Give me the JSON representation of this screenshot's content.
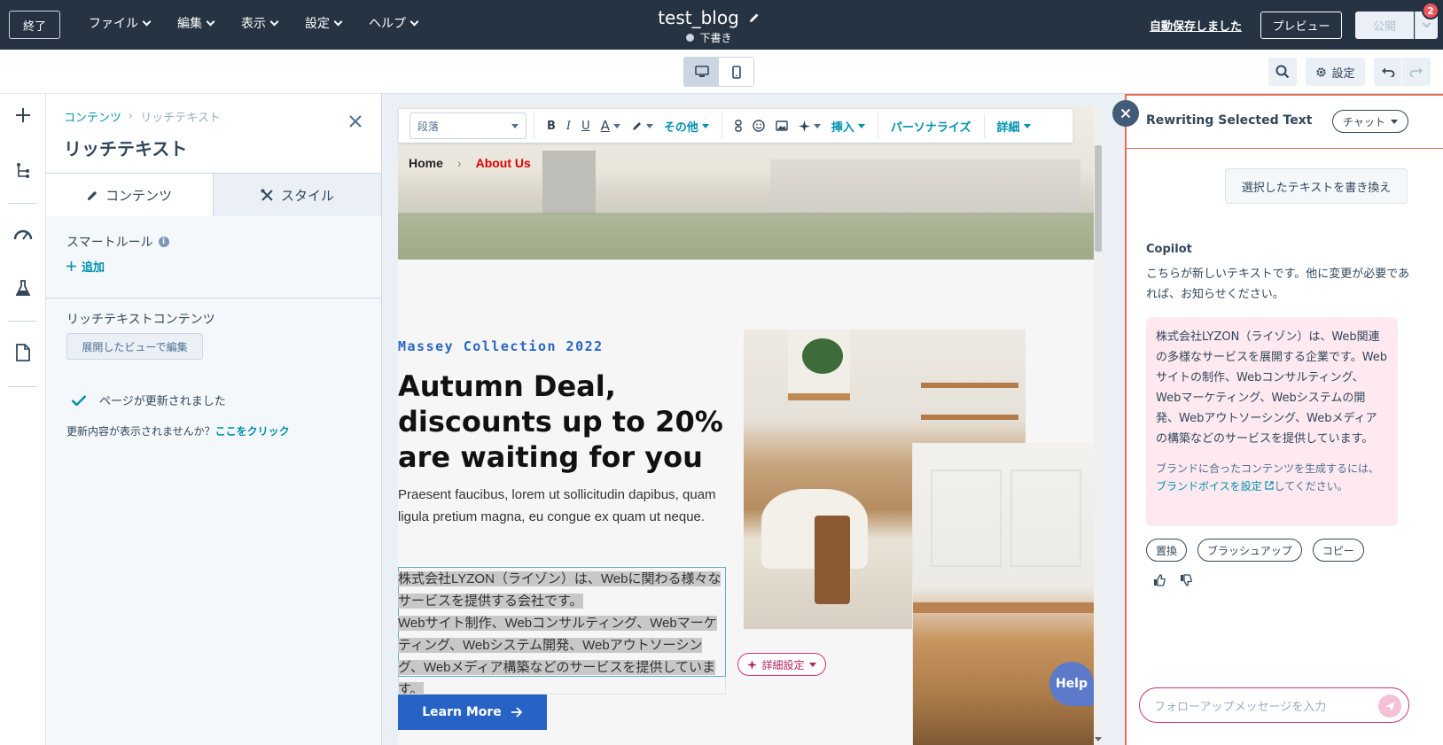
{
  "topbar": {
    "exit_label": "終了",
    "menu": [
      {
        "label": "ファイル"
      },
      {
        "label": "編集"
      },
      {
        "label": "表示"
      },
      {
        "label": "設定"
      },
      {
        "label": "ヘルプ"
      }
    ],
    "page_title": "test_blog",
    "status": "下書き",
    "autosave": "自動保存しました",
    "preview_label": "プレビュー",
    "publish_label": "公開",
    "notification_count": "2"
  },
  "viewbar": {
    "settings_label": "設定"
  },
  "sidepanel": {
    "breadcrumb_parent": "コンテンツ",
    "breadcrumb_current": "リッチテキスト",
    "title": "リッチテキスト",
    "tab_content": "コンテンツ",
    "tab_style": "スタイル",
    "smart_rule_label": "スマートルール",
    "add_label": "追加",
    "richtext_label": "リッチテキストコンテンツ",
    "expand_label": "展開したビューで編集",
    "updated_msg": "ページが更新されました",
    "refresh_hint": "更新内容が表示されませんか？",
    "refresh_link": "ここをクリック"
  },
  "rte": {
    "paragraph_select": "段落",
    "bold": "B",
    "italic": "I",
    "underline": "U",
    "font_color": "A",
    "more_label": "その他",
    "insert_label": "挿入",
    "personalize_label": "パーソナライズ",
    "detail_label": "詳細"
  },
  "page": {
    "breadcrumb_home": "Home",
    "breadcrumb_current": "About Us",
    "eyebrow": "Massey Collection 2022",
    "heading": "Autumn Deal, discounts up to 20% are waiting for you",
    "body": "Praesent faucibus, lorem ut sollicitudin dapibus, quam ligula pretium magna, eu congue ex quam ut neque.",
    "selected_line1": "株式会社LYZON（ライゾン）は、Webに関わる様々なサービスを提供する会社です。",
    "selected_line2": "Webサイト制作、Webコンサルティング、Webマーケティング、Webシステム開発、Webアウトソーシング、Webメディア構築などのサービスを提供しています。",
    "cta_label": "Learn More",
    "detail_settings": "詳細設定",
    "help_label": "Help"
  },
  "copilot": {
    "title": "Rewriting Selected Text",
    "mode_label": "チャット",
    "user_message": "選択したテキストを書き換え",
    "bot_name": "Copilot",
    "bot_intro": "こちらが新しいテキストです。他に変更が必要であれば、お知らせください。",
    "result_text": "株式会社LYZON（ライゾン）は、Web関連の多様なサービスを展開する企業です。Webサイトの制作、Webコンサルティング、Webマーケティング、Webシステムの開発、Webアウトソーシング、Webメディアの構築などのサービスを提供しています。",
    "note_prefix": "ブランドに合ったコンテンツを生成するには、",
    "note_link": "ブランドボイスを設定",
    "note_suffix": "してください。",
    "chips": [
      {
        "label": "置換"
      },
      {
        "label": "ブラッシュアップ"
      },
      {
        "label": "コピー"
      }
    ],
    "input_placeholder": "フォローアップメッセージを入力"
  },
  "colors": {
    "topbar": "#253342",
    "accent_teal": "#0091ae",
    "copilot_border": "#e66e50",
    "cta_blue": "#2663c4",
    "result_bg": "#fde9ef"
  }
}
